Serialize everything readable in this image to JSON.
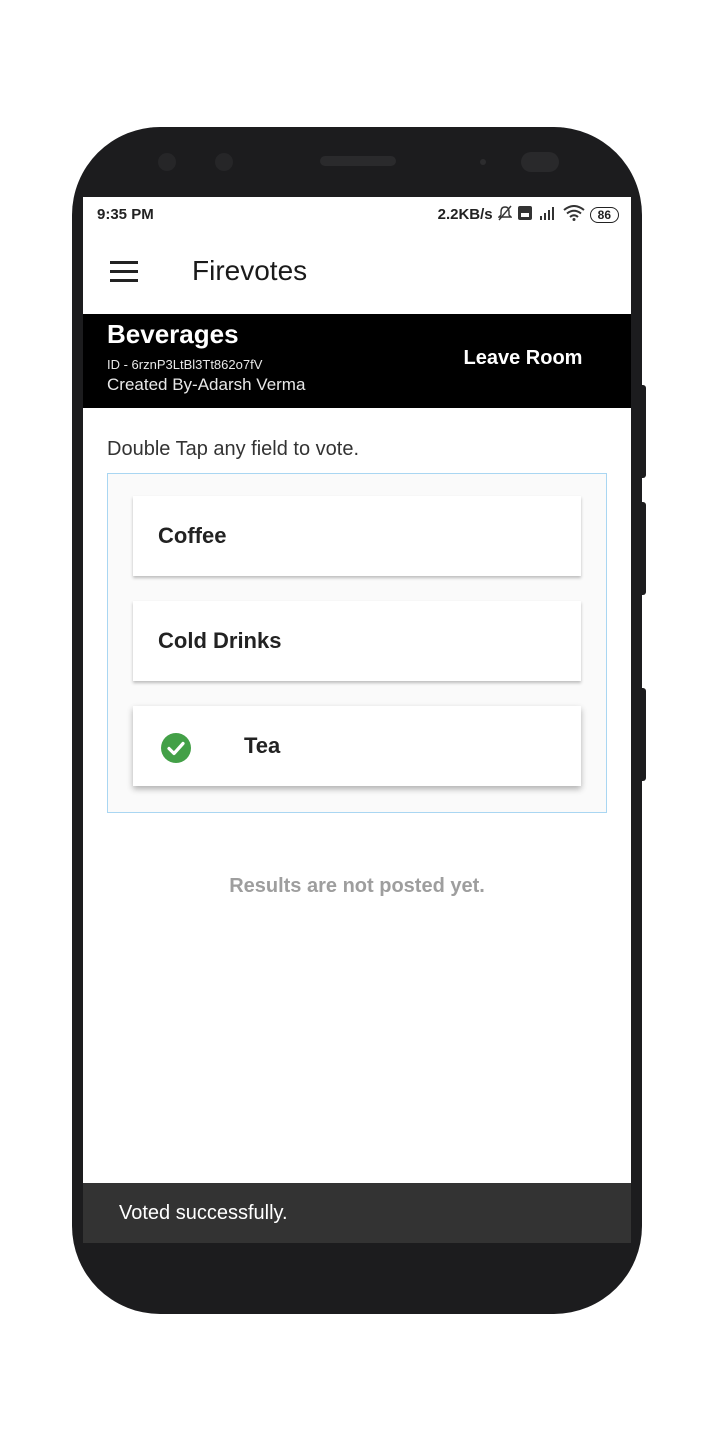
{
  "status_bar": {
    "time": "9:35 PM",
    "network_speed": "2.2KB/s",
    "icons": [
      "bell-off-icon",
      "volte-icon",
      "signal-4g-icon",
      "wifi-icon"
    ],
    "battery": "86"
  },
  "app_bar": {
    "menu_icon": "hamburger-menu-icon",
    "title": "Firevotes"
  },
  "room": {
    "name": "Beverages",
    "id_text": "ID - 6rznP3LtBl3Tt862o7fV",
    "creator_text": "Created By-Adarsh Verma",
    "leave_label": "Leave Room"
  },
  "instruction": "Double Tap any field to vote.",
  "options": [
    {
      "label": "Coffee",
      "voted": false
    },
    {
      "label": "Cold Drinks",
      "voted": false
    },
    {
      "label": "Tea",
      "voted": true
    }
  ],
  "results_text": "Results are not posted yet.",
  "snackbar": "Voted successfully.",
  "colors": {
    "check_green": "#43a047",
    "header_bg": "#000000",
    "snackbar_bg": "#333333",
    "list_border": "#a9d6f2"
  }
}
